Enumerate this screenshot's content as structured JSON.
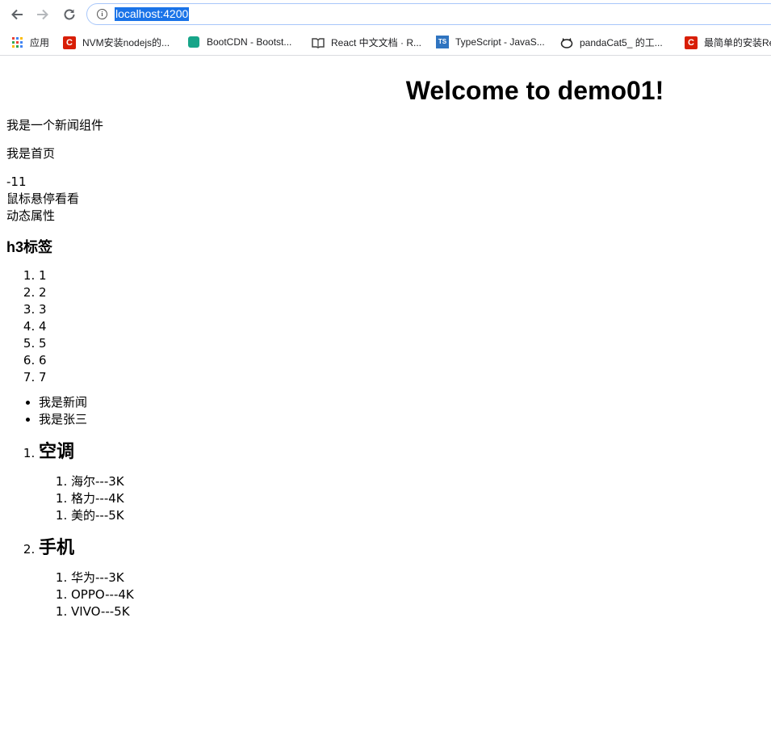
{
  "browser": {
    "url": "localhost:4200",
    "bookmarks": [
      {
        "label": "应用",
        "icon": "apps-grid-icon"
      },
      {
        "label": "NVM安装nodejs的...",
        "icon": "csdn-icon"
      },
      {
        "label": "BootCDN - Bootst...",
        "icon": "bootcdn-icon"
      },
      {
        "label": "React 中文文档 · R...",
        "icon": "book-icon"
      },
      {
        "label": "TypeScript - JavaS...",
        "icon": "typescript-icon"
      },
      {
        "label": "pandaCat5_ 的工...",
        "icon": "github-cat-icon"
      },
      {
        "label": "最简单的安装Re",
        "icon": "csdn-icon"
      }
    ]
  },
  "page": {
    "title": "Welcome to demo01!",
    "news_component": "我是一个新闻组件",
    "home": "我是首页",
    "number": "-11",
    "hover_text": "鼠标悬停看看",
    "dynamic_attr": "动态属性",
    "h3": "h3标签",
    "numbers": [
      "1",
      "2",
      "3",
      "4",
      "5",
      "6",
      "7"
    ],
    "bullets": [
      "我是新闻",
      "我是张三"
    ],
    "categories": [
      {
        "name": "空调",
        "items": [
          "海尔---3K",
          "格力---4K",
          "美的---5K"
        ]
      },
      {
        "name": "手机",
        "items": [
          "华为---3K",
          "OPPO---4K",
          "VIVO---5K"
        ]
      }
    ]
  }
}
